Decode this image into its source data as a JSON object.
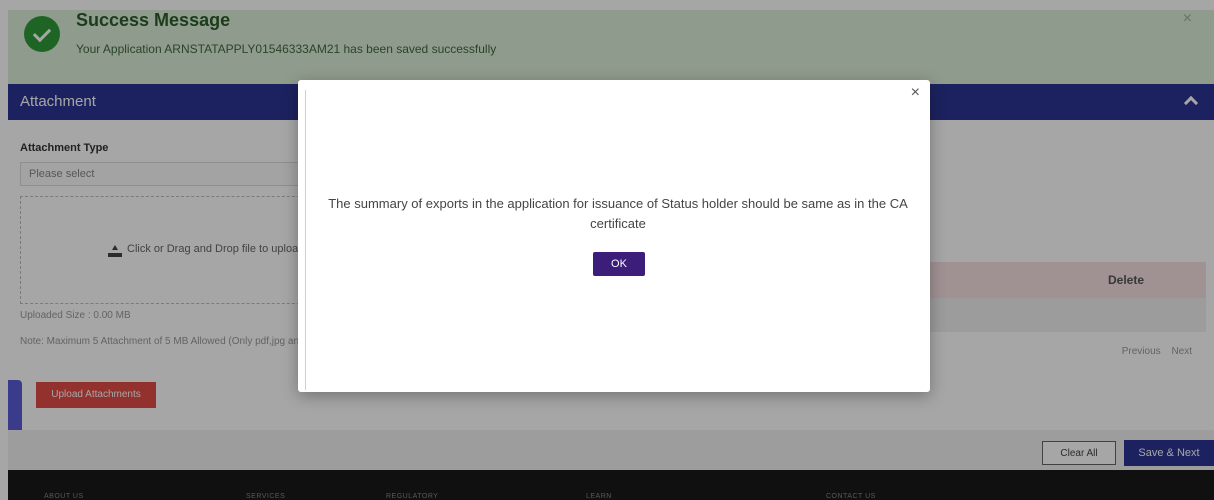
{
  "success": {
    "title": "Success Message",
    "message": "Your Application ARNSTATAPPLY01546333AM21 has been saved successfully",
    "close": "×"
  },
  "attachment": {
    "header": "Attachment",
    "type_label": "Attachment Type",
    "select_placeholder": "Please select",
    "dropzone_text": "Click or Drag and Drop file to upload",
    "uploaded_size": "Uploaded Size : 0.00 MB",
    "note": "Note: Maximum 5 Attachment of 5 MB Allowed (Only pdf,jpg and",
    "upload_button": "Upload Attachments"
  },
  "table": {
    "delete_header": "Delete",
    "pager": {
      "previous": "Previous",
      "next": "Next"
    }
  },
  "actions": {
    "clear_all": "Clear All",
    "save_next": "Save & Next"
  },
  "site_footer": {
    "about": "ABOUT US",
    "services": "SERVICES",
    "regulatory": "REGULATORY",
    "learn": "LEARN",
    "contact": "CONTACT US"
  },
  "modal": {
    "close": "×",
    "message": "The summary of exports in the application for issuance of Status holder should be same as in the CA certificate",
    "ok_label": "OK"
  },
  "colors": {
    "header_navy": "#2c3593",
    "success_green": "#2e9b3a",
    "ok_purple": "#3d1d7a",
    "upload_red": "#e04c46"
  }
}
